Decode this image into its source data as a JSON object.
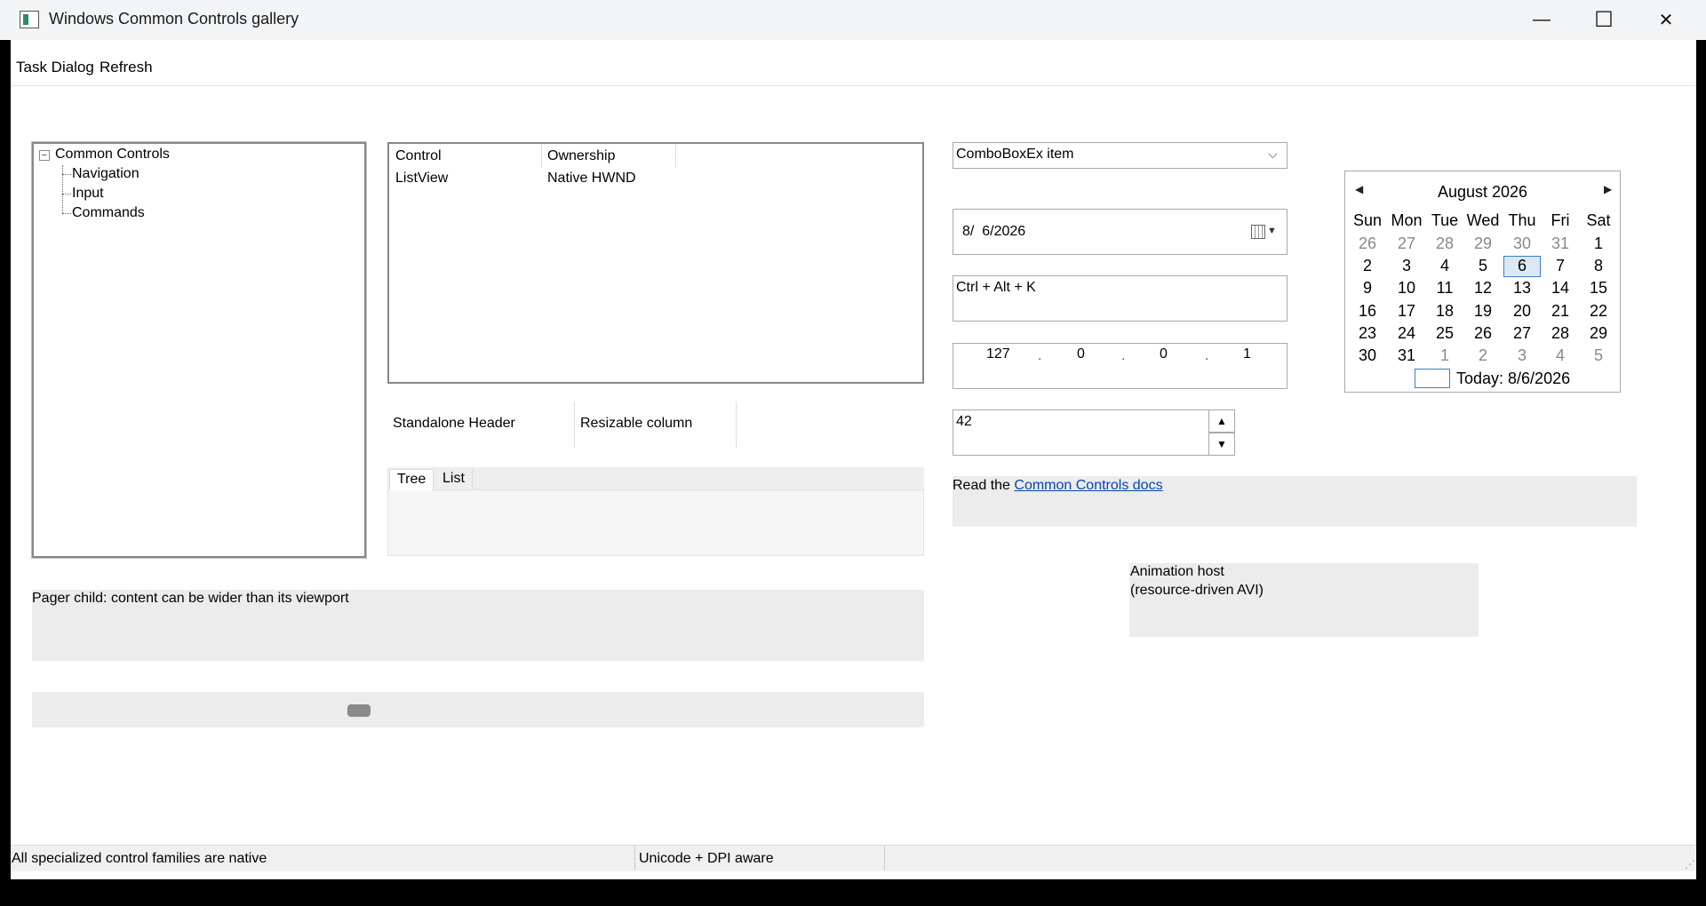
{
  "window": {
    "title": "Windows Common Controls gallery",
    "minimize_glyph": "—",
    "maximize_glyph": "☐",
    "close_glyph": "✕"
  },
  "menu": {
    "items": [
      "Task Dialog",
      "Refresh"
    ]
  },
  "tree": {
    "expander": "−",
    "root": "Common Controls",
    "children": [
      "Navigation",
      "Input",
      "Commands"
    ]
  },
  "listview": {
    "columns": [
      "Control",
      "Ownership"
    ],
    "rows": [
      [
        "ListView",
        "Native HWND"
      ]
    ]
  },
  "header": {
    "columns": [
      "Standalone Header",
      "Resizable column"
    ]
  },
  "tabs": {
    "items": [
      "Tree",
      "List"
    ],
    "selected": "Tree"
  },
  "pager": {
    "text": "Pager child: content can be wider than its viewport"
  },
  "trackbar": {
    "value": 0.36
  },
  "combobox": {
    "value": "ComboBoxEx item",
    "chevron": "⌵"
  },
  "datetime": {
    "value": "8/  6/2026",
    "dropdown_glyph": "▼"
  },
  "hotkey": {
    "value": "Ctrl + Alt + K"
  },
  "ip": {
    "octets": [
      "127",
      "0",
      "0",
      "1"
    ],
    "dot": "."
  },
  "updown": {
    "value": "42",
    "up_glyph": "▲",
    "down_glyph": "▼"
  },
  "syslink": {
    "prefix": "Read the ",
    "link": "Common Controls docs"
  },
  "animation": {
    "line1": "Animation host",
    "line2": "(resource-driven AVI)"
  },
  "calendar": {
    "title": "August 2026",
    "prev": "◀",
    "next": "▶",
    "dow": [
      "Sun",
      "Mon",
      "Tue",
      "Wed",
      "Thu",
      "Fri",
      "Sat"
    ],
    "weeks": [
      [
        "26",
        "27",
        "28",
        "29",
        "30",
        "31",
        "1"
      ],
      [
        "2",
        "3",
        "4",
        "5",
        "6",
        "7",
        "8"
      ],
      [
        "9",
        "10",
        "11",
        "12",
        "13",
        "14",
        "15"
      ],
      [
        "16",
        "17",
        "18",
        "19",
        "20",
        "21",
        "22"
      ],
      [
        "23",
        "24",
        "25",
        "26",
        "27",
        "28",
        "29"
      ],
      [
        "30",
        "31",
        "1",
        "2",
        "3",
        "4",
        "5"
      ]
    ],
    "selected": "6",
    "today_label": "Today: 8/6/2026"
  },
  "statusbar": {
    "parts": [
      "All specialized control families are native",
      "Unicode + DPI aware",
      ""
    ],
    "grip": "⋰"
  }
}
